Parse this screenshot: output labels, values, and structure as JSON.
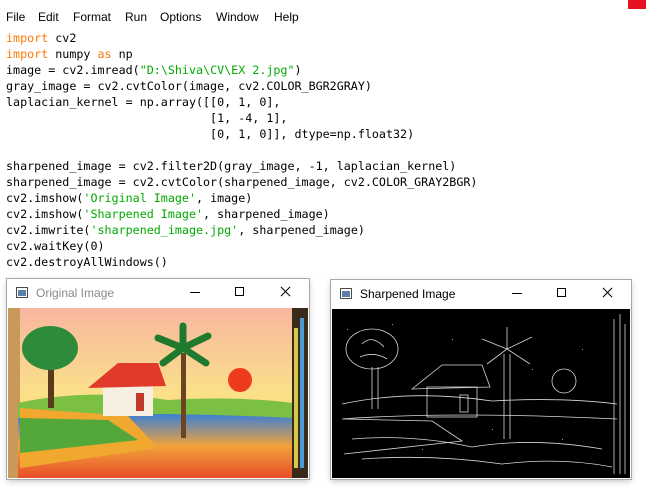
{
  "menubar": {
    "items": [
      "File",
      "Edit",
      "Format",
      "Run",
      "Options",
      "Window",
      "Help"
    ]
  },
  "editor": {
    "lines": [
      [
        {
          "t": "import",
          "c": "kw"
        },
        {
          "t": " cv2",
          "c": ""
        }
      ],
      [
        {
          "t": "import",
          "c": "kw"
        },
        {
          "t": " numpy ",
          "c": ""
        },
        {
          "t": "as",
          "c": "kw"
        },
        {
          "t": " np",
          "c": ""
        }
      ],
      [
        {
          "t": "image = cv2.imread(",
          "c": ""
        },
        {
          "t": "\"D:\\Shiva\\CV\\EX 2.jpg\"",
          "c": "str"
        },
        {
          "t": ")",
          "c": ""
        }
      ],
      [
        {
          "t": "gray_image = cv2.cvtColor(image, cv2.COLOR_BGR2GRAY)",
          "c": ""
        }
      ],
      [
        {
          "t": "laplacian_kernel = np.array([[0, 1, 0],",
          "c": ""
        }
      ],
      [
        {
          "t": "                             [1, -4, 1],",
          "c": ""
        }
      ],
      [
        {
          "t": "                             [0, 1, 0]], dtype=np.float32)",
          "c": ""
        }
      ],
      [
        {
          "t": "",
          "c": ""
        }
      ],
      [
        {
          "t": "sharpened_image = cv2.filter2D(gray_image, -1, laplacian_kernel)",
          "c": ""
        }
      ],
      [
        {
          "t": "sharpened_image = cv2.cvtColor(sharpened_image, cv2.COLOR_GRAY2BGR)",
          "c": ""
        }
      ],
      [
        {
          "t": "cv2.imshow(",
          "c": ""
        },
        {
          "t": "'Original Image'",
          "c": "str"
        },
        {
          "t": ", image)",
          "c": ""
        }
      ],
      [
        {
          "t": "cv2.imshow(",
          "c": ""
        },
        {
          "t": "'Sharpened Image'",
          "c": "str"
        },
        {
          "t": ", sharpened_image)",
          "c": ""
        }
      ],
      [
        {
          "t": "cv2.imwrite(",
          "c": ""
        },
        {
          "t": "'sharpened_image.jpg'",
          "c": "str"
        },
        {
          "t": ", sharpened_image)",
          "c": ""
        }
      ],
      [
        {
          "t": "cv2.waitKey(0)",
          "c": ""
        }
      ],
      [
        {
          "t": "cv2.destroyAllWindows()",
          "c": ""
        }
      ]
    ]
  },
  "windows": {
    "original": {
      "title": "Original Image",
      "icon": "image-window-icon"
    },
    "sharpened": {
      "title": "Sharpened Image",
      "icon": "image-window-icon"
    }
  },
  "colors": {
    "keyword": "#ff7700",
    "string": "#00aa00",
    "close_accent": "#e81123"
  }
}
